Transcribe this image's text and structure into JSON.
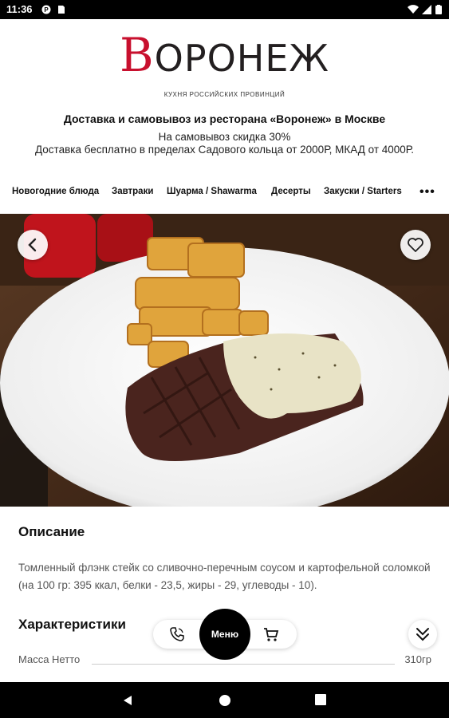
{
  "status_bar": {
    "time": "11:36",
    "left_icons": [
      "sync-icon",
      "sim-card-icon"
    ],
    "right_icons": [
      "wifi-icon",
      "signal-icon",
      "battery-icon"
    ]
  },
  "brand": {
    "logo_initial": "В",
    "logo_rest": "ОРОНЕЖ",
    "subtitle": "КУХНЯ РОССИЙСКИХ ПРОВИНЦИЙ",
    "accent_color": "#c8102e"
  },
  "header": {
    "title": "Доставка и самовывоз из ресторана «Воронеж» в Москве",
    "promo_line1": "На самовывоз скидка 30%",
    "promo_line2": "Доставка бесплатно в пределах Садового кольца от 2000Р, МКАД от 4000Р."
  },
  "categories": {
    "items": [
      "Новогодние блюда",
      "Завтраки",
      "Шуарма / Shawarma",
      "Десерты",
      "Закуски / Starters"
    ],
    "more_label": "•••"
  },
  "hero": {
    "back_icon": "chevron-left-icon",
    "favorite_icon": "heart-outline-icon",
    "image_subject": "flank-steak-with-potato-wedges"
  },
  "description": {
    "heading": "Описание",
    "text": "Томленный флэнк стейк со сливочно-перечным соусом и картофельной соломкой (на 100 гр: 395 ккал, белки - 23,5, жиры - 29, углеводы - 10)."
  },
  "specs": {
    "heading": "Характеристики",
    "rows": [
      {
        "key": "Масса Нетто",
        "value": "310гр"
      }
    ]
  },
  "bottom_bar": {
    "phone_icon": "phone-icon",
    "menu_label": "Меню",
    "cart_icon": "cart-icon",
    "scroll_icon": "double-chevron-down-icon"
  },
  "nav_bar": {
    "buttons": [
      "back-icon",
      "home-icon",
      "recents-icon"
    ]
  }
}
